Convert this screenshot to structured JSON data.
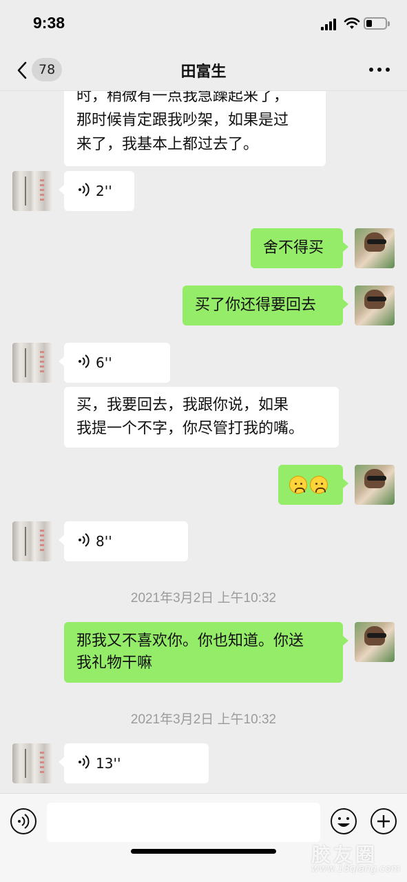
{
  "status_bar": {
    "time": "9:38"
  },
  "nav": {
    "unread_count": "78",
    "title": "田富生"
  },
  "messages": {
    "m1": "时，稍微有一点我急躁起来了，\n那时候肯定跟我吵架，如果是过\n来了，我基本上都过去了。",
    "m2_voice": "2''",
    "m3": "舍不得买",
    "m4": "买了你还得要回去",
    "m5_voice": "6''",
    "m6": "买，我要回去，我跟你说，如果\n我提一个不字，你尽管打我的嘴。",
    "m8_voice": "8''",
    "ts1": "2021年3月2日 上午10:32",
    "m9": "那我又不喜欢你。你也知道。你送\n我礼物干嘛",
    "ts2": "2021年3月2日 上午10:32",
    "m10_voice": "13''"
  },
  "icons": {
    "voice_toggle": "voice-mode-icon",
    "emoji": "emoji-icon",
    "plus": "plus-icon"
  },
  "watermark": {
    "text": "胶友圈",
    "url": "www.18qiang.com"
  },
  "colors": {
    "outgoing_bubble": "#95ec69",
    "incoming_bubble": "#ffffff",
    "background": "#ededed"
  }
}
